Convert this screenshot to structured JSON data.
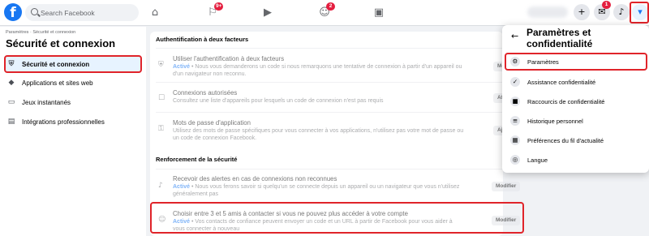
{
  "topbar": {
    "logo": "f",
    "search_placeholder": "Search Facebook",
    "nav_icons": [
      "home-icon",
      "flag-icon",
      "video-icon",
      "groups-icon",
      "gaming-icon"
    ],
    "flag_badge": "9+",
    "groups_badge": "2",
    "messenger_badge": "1"
  },
  "sidebar": {
    "breadcrumb": "Paramètres · Sécurité et connexion",
    "title": "Sécurité et connexion",
    "items": [
      {
        "label": "Sécurité et connexion",
        "icon": "shield-icon"
      },
      {
        "label": "Applications et sites web",
        "icon": "cube-icon"
      },
      {
        "label": "Jeux instantanés",
        "icon": "gamepad-icon"
      },
      {
        "label": "Intégrations professionnelles",
        "icon": "briefcase-icon"
      }
    ]
  },
  "main": {
    "two_factor": {
      "heading": "Authentification à deux facteurs",
      "rows": [
        {
          "title": "Utiliser l'authentification à deux facteurs",
          "status": "Activé",
          "desc1": " • Nous vous demanderons un code si nous remarquons une tentative de connexion à partir d'un appareil ou",
          "desc2": "d'un navigateur non reconnu.",
          "button": "Modifier"
        },
        {
          "title": "Connexions autorisées",
          "desc1": "Consultez une liste d'appareils pour lesquels un code de connexion n'est pas requis",
          "button": "Afficher"
        },
        {
          "title": "Mots de passe d'application",
          "desc1": "Utilisez des mots de passe spécifiques pour vous connecter à vos applications, n'utilisez pas votre mot de passe ou",
          "desc2": "un code de connexion Facebook.",
          "button": "Ajouter"
        }
      ]
    },
    "security": {
      "heading": "Renforcement de la sécurité",
      "rows": [
        {
          "title": "Recevoir des alertes en cas de connexions non reconnues",
          "status": "Activé",
          "desc1": " • Nous vous ferons savoir si quelqu'un se connecte depuis un appareil ou un navigateur que vous n'utilisez",
          "desc2": "généralement pas",
          "button": "Modifier"
        },
        {
          "title": "Choisir entre 3 et 5 amis à contacter si vous ne pouvez plus accéder à votre compte",
          "status": "Activé",
          "desc1": " • Vos contacts de confiance peuvent envoyer un code et un URL à partir de Facebook pour vous aider à",
          "desc2": "vous connecter à nouveau",
          "button": "Modifier"
        }
      ]
    }
  },
  "dropdown": {
    "title": "Paramètres et confidentialité",
    "items": [
      {
        "label": "Paramètres",
        "icon": "gear-icon"
      },
      {
        "label": "Assistance confidentialité",
        "icon": "lock-check-icon"
      },
      {
        "label": "Raccourcis de confidentialité",
        "icon": "lock-icon"
      },
      {
        "label": "Historique personnel",
        "icon": "list-icon"
      },
      {
        "label": "Préférences du fil d'actualité",
        "icon": "feed-icon"
      },
      {
        "label": "Langue",
        "icon": "globe-icon"
      }
    ]
  },
  "colors": {
    "brand": "#1877f2",
    "highlight_red": "#e0242a",
    "badge_red": "#e41e3f"
  }
}
